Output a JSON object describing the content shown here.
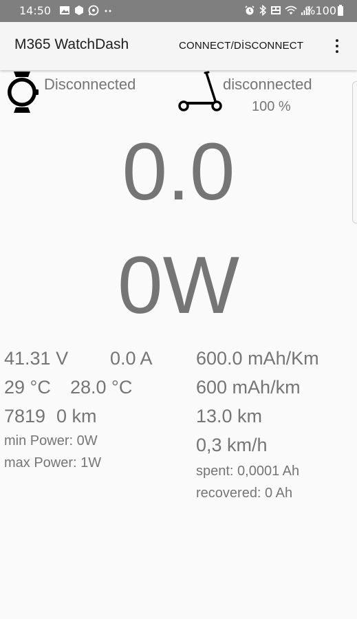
{
  "status_bar": {
    "time": "14:50",
    "battery": "%100",
    "left_icons": [
      "image-icon",
      "hexagon-icon",
      "whatsapp-icon",
      "more-dots-icon"
    ],
    "right_icons": [
      "alarm-icon",
      "bluetooth-icon",
      "volte-icon",
      "wifi-icon",
      "signal-icon",
      "battery-icon"
    ]
  },
  "app_bar": {
    "title": "M365 WatchDash",
    "connect_label": "CONNECT/DİSCONNECT"
  },
  "watch": {
    "status": "Disconnected"
  },
  "scooter": {
    "status": "disconnected",
    "battery": "100 %"
  },
  "main": {
    "speed": "0.0",
    "power": "0W"
  },
  "stats": {
    "voltage": "41.31 V",
    "current": "0.0 A",
    "temp1": "29 °C",
    "temp2": "28.0 °C",
    "odometer": "7819",
    "trip": "0 km",
    "min_power": "min Power: 0W",
    "max_power": "max Power: 1W",
    "consumption1": "600.0 mAh/Km",
    "consumption2": "600 mAh/km",
    "range": "13.0 km",
    "avg_speed": "0,3 km/h",
    "spent": "spent: 0,0001 Ah",
    "recovered": "recovered: 0 Ah"
  },
  "colors": {
    "status_bar": "#7f7f7f",
    "app_bar": "#f5f5f5",
    "background": "#fafafa",
    "text_gray": "#757575"
  }
}
